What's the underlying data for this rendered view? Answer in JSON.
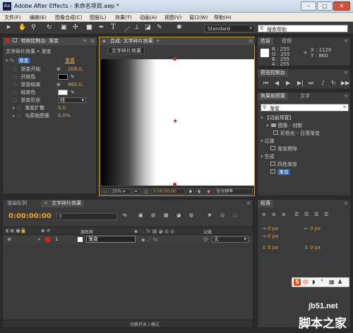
{
  "window": {
    "title": "Adobe After Effects - 未命名项目.aep *",
    "app_icon": "Ae",
    "controls": [
      "minimize-icon",
      "maximize-icon",
      "close-icon"
    ]
  },
  "menu": [
    "文件(F)",
    "编辑(E)",
    "图像合成(C)",
    "图层(L)",
    "效果(T)",
    "动画(A)",
    "视图(V)",
    "窗口(W)",
    "帮助(H)"
  ],
  "toolbar": {
    "workspace": "Standard",
    "search_placeholder": "搜索帮助"
  },
  "effect_controls": {
    "tab": "特效控制台: 渐变",
    "header": "文字碎片效果 • 渐变",
    "effect_name": "渐变",
    "reset": "重置",
    "rows": [
      {
        "label": "渐变开始",
        "value": "208.0,"
      },
      {
        "label": "开始色",
        "value": ""
      },
      {
        "label": "渐变结束",
        "value": "960.0,"
      },
      {
        "label": "结束色",
        "value": ""
      },
      {
        "label": "渐变形状",
        "value": "线"
      },
      {
        "label": "渐变扩散",
        "value": "0.0"
      },
      {
        "label": "与原始图像",
        "value": "0.0%"
      }
    ]
  },
  "composition": {
    "tab": "合成: 文字碎片效果",
    "subtab": "文字碎片效果",
    "zoom": "25%",
    "timecode": "0:00:00:00",
    "resolution": "全分辨率"
  },
  "info": {
    "tab": "信息",
    "tab2": "音频",
    "r": "R : 255",
    "g": "G : 255",
    "b": "B : 255",
    "a": "A : 255",
    "x": "X : 1120",
    "y": "Y : 860"
  },
  "preview": {
    "tab": "预览控制台"
  },
  "effects_presets": {
    "tab": "效果和预置",
    "tab2": "文字",
    "search_value": "渐变",
    "items": [
      {
        "label": "【动画预置】",
        "indent": 0
      },
      {
        "label": "图像 - 创新",
        "indent": 1
      },
      {
        "label": "彩色化 - 日落渐变",
        "indent": 2
      },
      {
        "label": "过渡",
        "indent": 0
      },
      {
        "label": "渐变擦除",
        "indent": 1
      },
      {
        "label": "生成",
        "indent": 0
      },
      {
        "label": "四色渐变",
        "indent": 1
      },
      {
        "label": "渐变",
        "indent": 1
      }
    ]
  },
  "timeline": {
    "tab1": "渲染队列",
    "tab2": "文字碎片效果",
    "timecode": "0:00:00:00",
    "col_source": "源名称",
    "col_parent": "父级",
    "layer_num": "1",
    "layer_name": "渐变",
    "parent_value": "无",
    "toggle_label": "切换开关 / 模式"
  },
  "paragraph": {
    "tab": "段落",
    "values": [
      "0 px",
      "0 px",
      "0 px",
      "0 px",
      "0 px"
    ]
  },
  "watermark": {
    "site": "jb51.net",
    "name": "脚本之家"
  },
  "colors": {
    "accent_orange": "#e7a13a",
    "timecode_orange": "#f0a030",
    "select_blue": "#2c5fa8",
    "layer_red": "#c0292e"
  }
}
